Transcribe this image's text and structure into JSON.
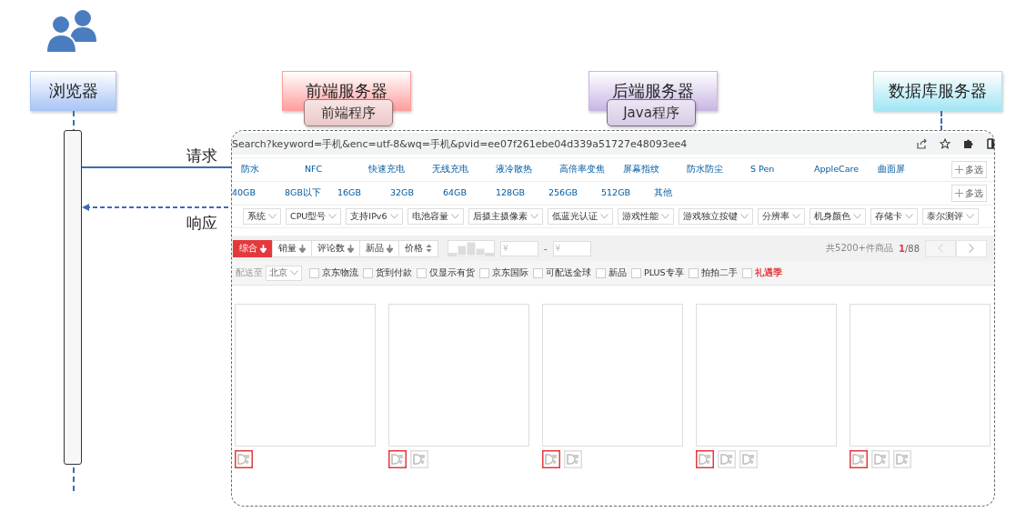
{
  "diagram": {
    "actors": [
      {
        "label": "浏览器",
        "color": "#a9c4f5"
      },
      {
        "label": "前端服务器",
        "color": "#ff9e9e"
      },
      {
        "label": "后端服务器",
        "color": "#c9b6e4"
      },
      {
        "label": "数据库服务器",
        "color": "#a3e6f4"
      }
    ],
    "components": [
      {
        "label": "前端程序"
      },
      {
        "label": "Java程序"
      }
    ],
    "messages": [
      {
        "label": "请求",
        "kind": "request"
      },
      {
        "label": "响应",
        "kind": "response"
      }
    ]
  },
  "browser_window": {
    "address": "Search?keyword=手机&enc=utf-8&wq=手机&pvid=ee07f261ebe04d339a51727e48093ee4",
    "category_rows": [
      {
        "items": [
          "防水",
          "NFC",
          "快速充电",
          "无线充电",
          "液冷散热",
          "高倍率变焦",
          "屏幕指纹",
          "防水防尘",
          "S Pen",
          "AppleCare",
          "曲面屏"
        ],
        "more": "多选"
      },
      {
        "items": [
          "40GB",
          "8GB以下",
          "16GB",
          "32GB",
          "64GB",
          "128GB",
          "256GB",
          "512GB",
          "其他"
        ],
        "more": "多选"
      }
    ],
    "filters": [
      "系统",
      "CPU型号",
      "支持IPv6",
      "电池容量",
      "后摄主摄像素",
      "低蓝光认证",
      "游戏性能",
      "游戏独立按键",
      "分辨率",
      "机身颜色",
      "存储卡",
      "泰尔测评"
    ],
    "sort_options": [
      {
        "label": "综合",
        "selected": true,
        "kind": "down"
      },
      {
        "label": "销量",
        "selected": false,
        "kind": "down"
      },
      {
        "label": "评论数",
        "selected": false,
        "kind": "down"
      },
      {
        "label": "新品",
        "selected": false,
        "kind": "down"
      },
      {
        "label": "价格",
        "selected": false,
        "kind": "updown"
      }
    ],
    "price_from_placeholder": "¥",
    "price_separator": "-",
    "price_to_placeholder": "¥",
    "result_count": "共5200+件商品",
    "page_current": "1",
    "page_total": "/88",
    "delivery_label": "配送至",
    "delivery_city": "北京",
    "service_options": [
      {
        "label": "京东物流",
        "checked": false,
        "highlight": false
      },
      {
        "label": "货到付款",
        "checked": false,
        "highlight": false
      },
      {
        "label": "仅显示有货",
        "checked": false,
        "highlight": false
      },
      {
        "label": "京东国际",
        "checked": false,
        "highlight": false
      },
      {
        "label": "可配送全球",
        "checked": false,
        "highlight": false
      },
      {
        "label": "新品",
        "checked": false,
        "highlight": false
      },
      {
        "label": "PLUS专享",
        "checked": false,
        "highlight": false
      },
      {
        "label": "拍拍二手",
        "checked": false,
        "highlight": false
      },
      {
        "label": "礼遇季",
        "checked": false,
        "highlight": true
      }
    ],
    "products": [
      {
        "swatches": [
          {
            "selected": true
          }
        ]
      },
      {
        "swatches": [
          {
            "selected": true
          },
          {
            "selected": false
          }
        ]
      },
      {
        "swatches": [
          {
            "selected": true
          },
          {
            "selected": false
          }
        ]
      },
      {
        "swatches": [
          {
            "selected": true
          },
          {
            "selected": false
          },
          {
            "selected": false
          }
        ]
      },
      {
        "swatches": [
          {
            "selected": true
          },
          {
            "selected": false
          },
          {
            "selected": false
          }
        ]
      }
    ]
  }
}
